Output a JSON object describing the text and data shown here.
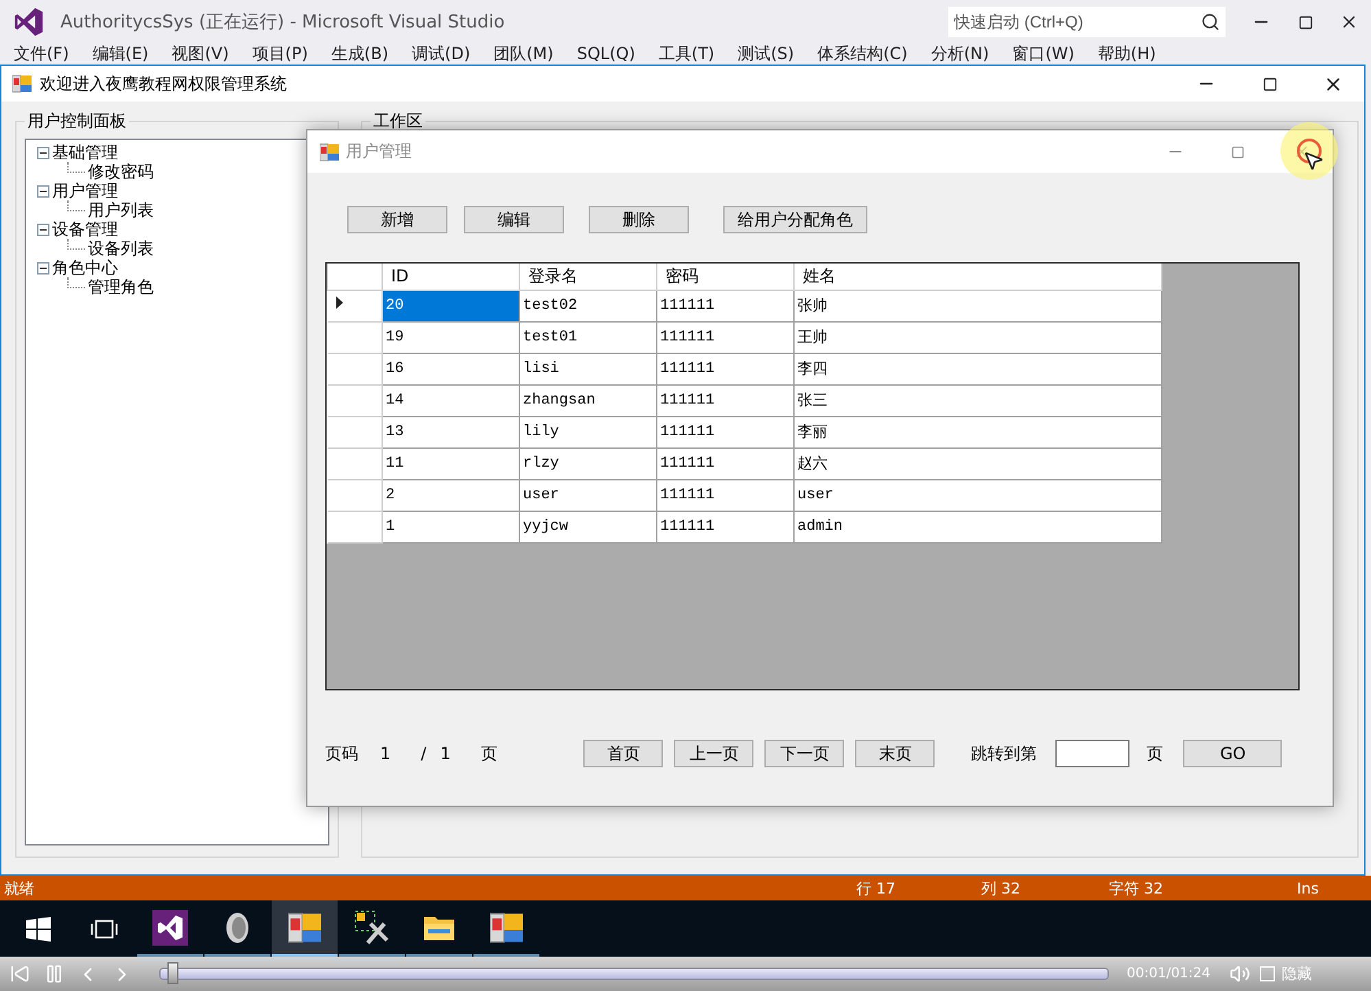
{
  "ide": {
    "title": "AuthoritycsSys (正在运行) - Microsoft Visual Studio",
    "quick_launch": {
      "placeholder": "快速启动 (Ctrl+Q)"
    },
    "menu": [
      "文件(F)",
      "编辑(E)",
      "视图(V)",
      "项目(P)",
      "生成(B)",
      "调试(D)",
      "团队(M)",
      "SQL(Q)",
      "工具(T)",
      "测试(S)",
      "体系结构(C)",
      "分析(N)",
      "窗口(W)",
      "帮助(H)"
    ]
  },
  "main_window": {
    "title": "欢迎进入夜鹰教程网权限管理系统",
    "left_panel": {
      "title": "用户控制面板",
      "tree": [
        {
          "label": "基础管理",
          "expanded": true,
          "children": [
            {
              "label": "修改密码"
            }
          ]
        },
        {
          "label": "用户管理",
          "expanded": true,
          "children": [
            {
              "label": "用户列表"
            }
          ]
        },
        {
          "label": "设备管理",
          "expanded": true,
          "children": [
            {
              "label": "设备列表"
            }
          ]
        },
        {
          "label": "角色中心",
          "expanded": true,
          "children": [
            {
              "label": "管理角色"
            }
          ]
        }
      ]
    },
    "work_area": {
      "title": "工作区"
    }
  },
  "dialog": {
    "title": "用户管理",
    "toolbar": [
      "新增",
      "编辑",
      "删除",
      "给用户分配角色"
    ],
    "table": {
      "columns": [
        "ID",
        "登录名",
        "密码",
        "姓名"
      ],
      "rows": [
        {
          "cells": [
            "20",
            "test02",
            "111111",
            "张帅"
          ],
          "selected": true
        },
        {
          "cells": [
            "19",
            "test01",
            "111111",
            "王帅"
          ],
          "selected": false
        },
        {
          "cells": [
            "16",
            "lisi",
            "111111",
            "李四"
          ],
          "selected": false
        },
        {
          "cells": [
            "14",
            "zhangsan",
            "111111",
            "张三"
          ],
          "selected": false
        },
        {
          "cells": [
            "13",
            "lily",
            "111111",
            "李丽"
          ],
          "selected": false
        },
        {
          "cells": [
            "11",
            "rlzy",
            "111111",
            "赵六"
          ],
          "selected": false
        },
        {
          "cells": [
            "2",
            "user",
            "111111",
            "user"
          ],
          "selected": false
        },
        {
          "cells": [
            "1",
            "yyjcw",
            "111111",
            "admin"
          ],
          "selected": false
        }
      ]
    },
    "pager": {
      "label": "页码",
      "current": "1",
      "separator": "/",
      "total": "1",
      "unit": "页",
      "buttons": [
        "首页",
        "上一页",
        "下一页",
        "末页"
      ],
      "jump_label": "跳转到第",
      "jump_unit": "页",
      "go": "GO"
    }
  },
  "status_bar": {
    "state": "就绪",
    "line": "行 17",
    "col": "列 32",
    "char": "字符 32",
    "mode": "Ins"
  },
  "taskbar": {
    "apps": [
      {
        "kind": "vs",
        "selected": false
      },
      {
        "kind": "media",
        "selected": false
      },
      {
        "kind": "form",
        "selected": true
      },
      {
        "kind": "tools",
        "selected": false
      },
      {
        "kind": "folder",
        "selected": false
      },
      {
        "kind": "form",
        "selected": false
      }
    ]
  },
  "player": {
    "time": "00:01/01:24",
    "level": 0.01,
    "hide_label": "隐藏",
    "hide_checked": false
  }
}
